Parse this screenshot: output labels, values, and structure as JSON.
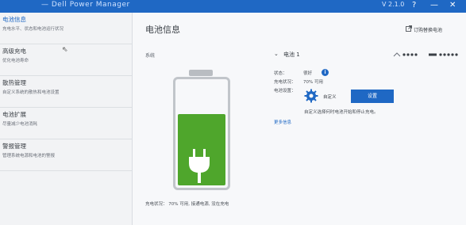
{
  "window": {
    "title": "— Dell Power Manager",
    "version": "V 2.1.0",
    "help_icon": "question-icon",
    "minimize_icon": "minimize-icon",
    "close_icon": "close-icon"
  },
  "sidebar": {
    "items": [
      {
        "label": "电池信息",
        "sub": "充电水平、状态和电池运行状况",
        "active": true
      },
      {
        "label": "高级充电",
        "sub": "优化电池寿命",
        "active": false
      },
      {
        "label": "散热管理",
        "sub": "自定义系统的散热和电池设置",
        "active": false
      },
      {
        "label": "电池扩展",
        "sub": "尽量减少电池消耗",
        "active": false
      },
      {
        "label": "警报管理",
        "sub": "管理系统电源和电池的警报",
        "active": false
      }
    ]
  },
  "main": {
    "title": "电池信息",
    "link_text": "订购替换电池",
    "section_label": "系统",
    "battery_level": 0.7,
    "status_line": "充电状况： 70% 可用, 接通电源, 没在充电",
    "battery": {
      "name": "电池 1",
      "status_label": "状态：",
      "status_value": "很好",
      "charge_label": "充电状况：",
      "charge_value": "70% 可用",
      "setting_label": "电池设置：",
      "mode_value": "自定义",
      "settings_button": "设置",
      "description": "自定义选择何时电池开始和停止充电。",
      "more_link": "更多信息"
    }
  },
  "colors": {
    "accent": "#1f68c4",
    "battery_fill": "#4fa62c"
  }
}
